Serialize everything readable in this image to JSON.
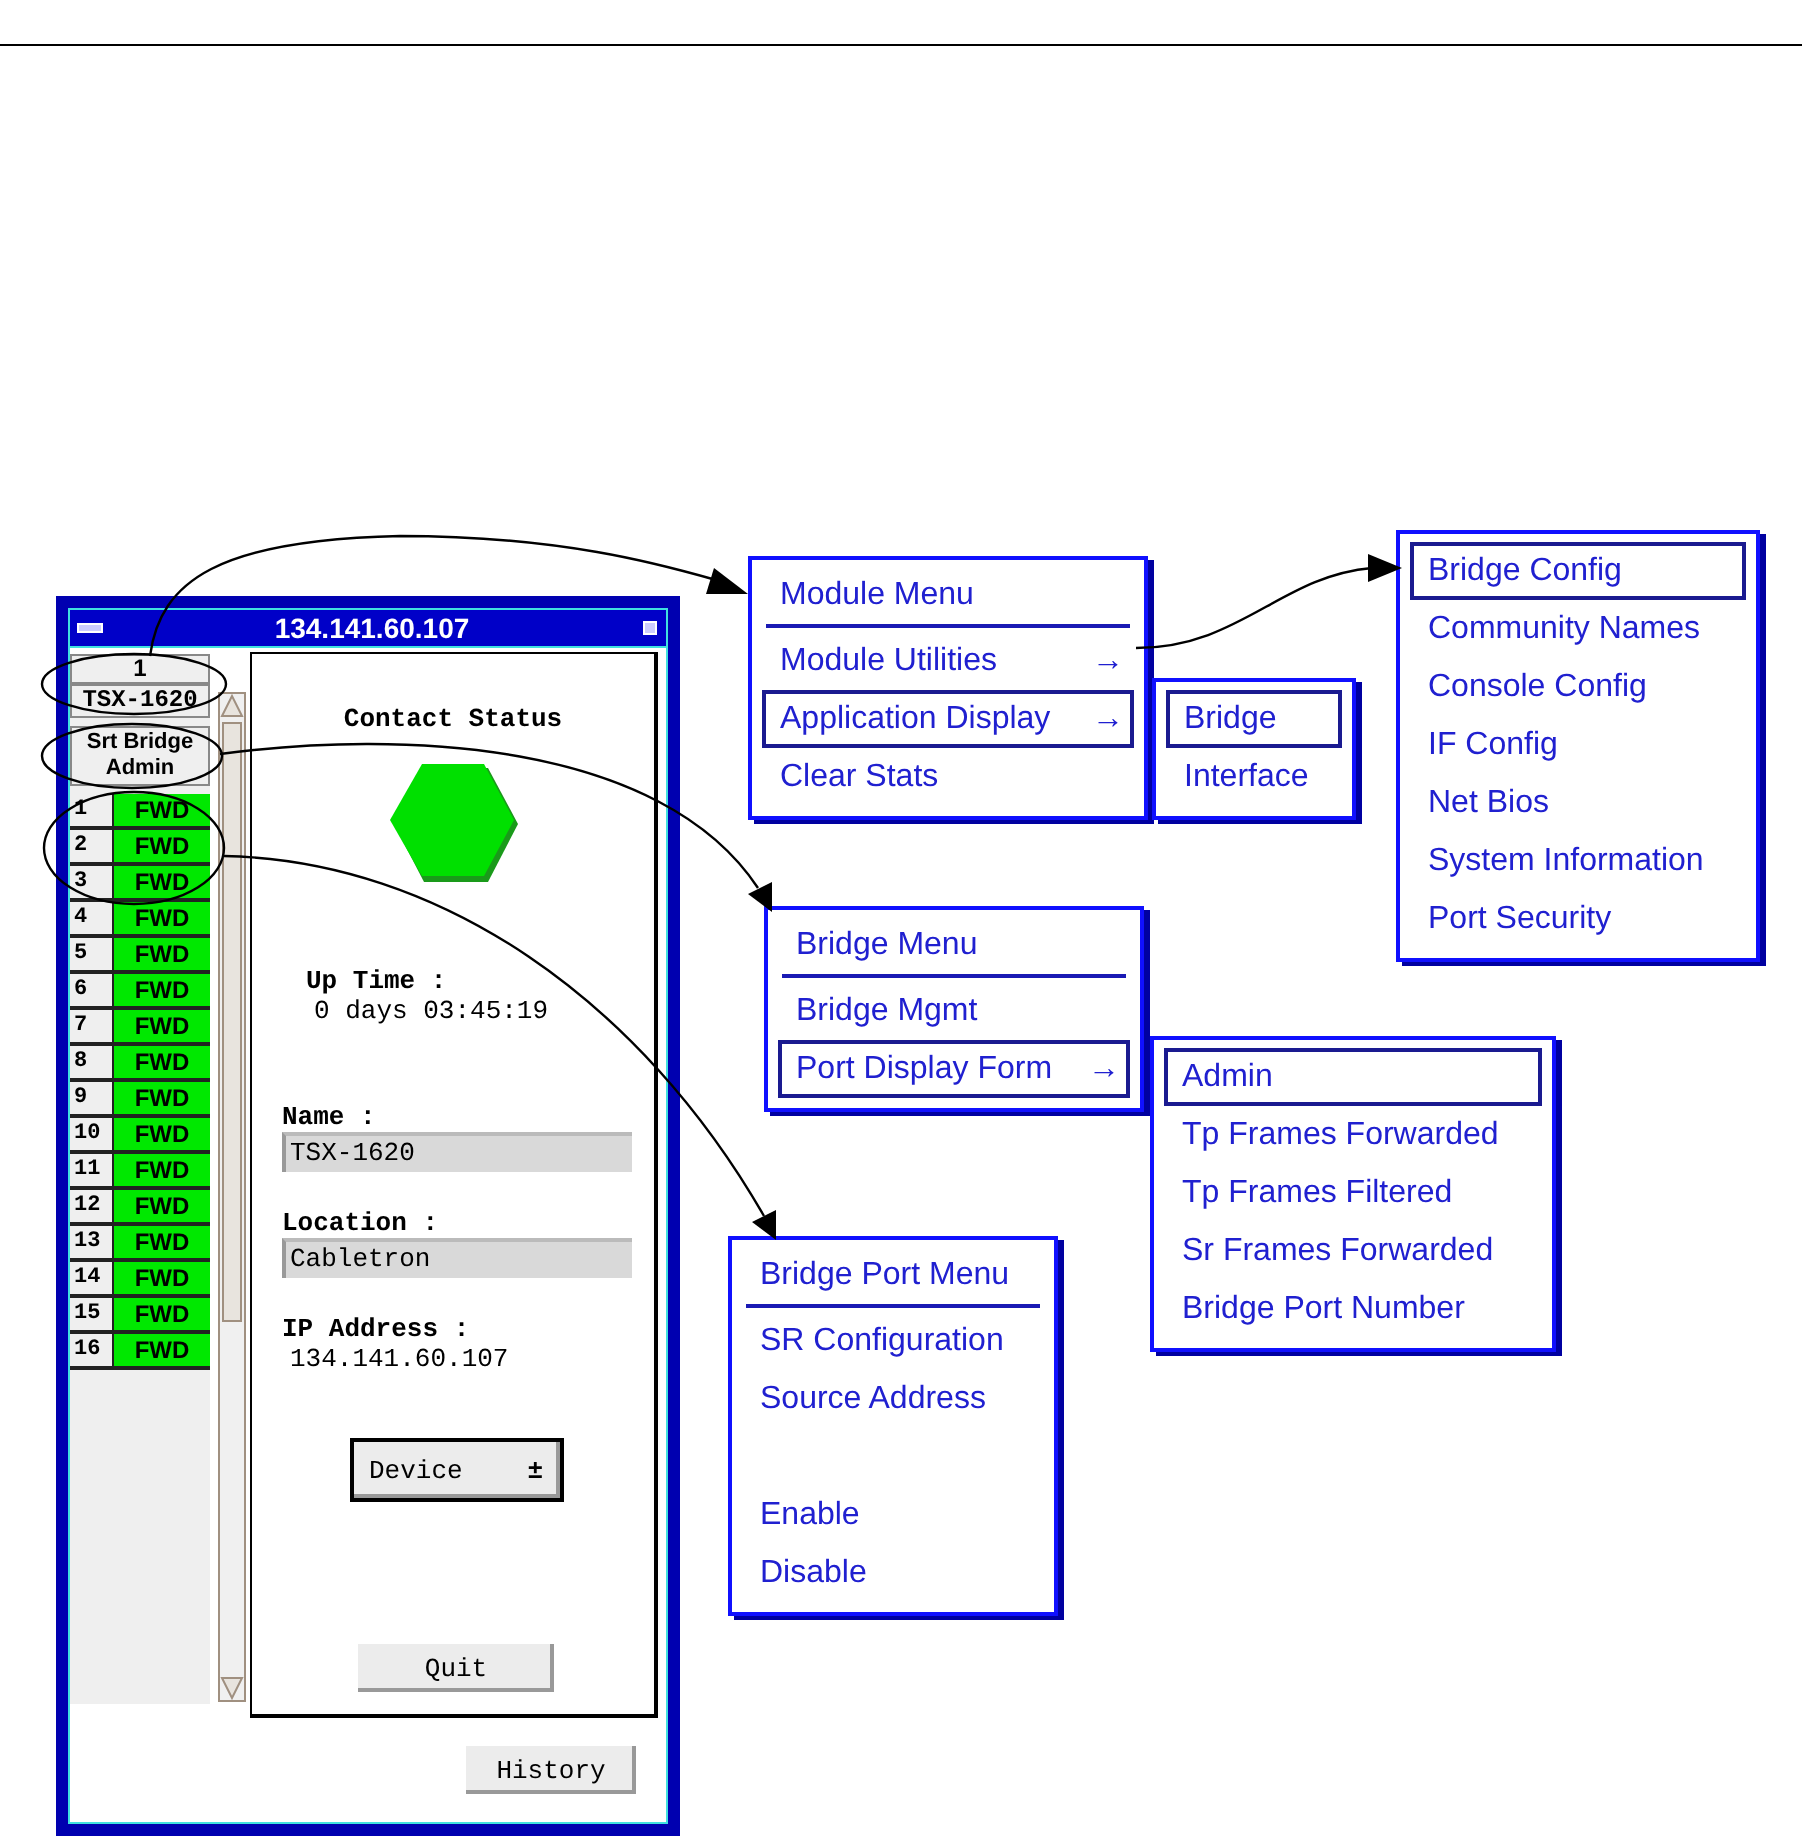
{
  "window": {
    "title": "134.141.60.107",
    "port_list": {
      "index": "1",
      "device": "TSX-1620",
      "mode": "Srt Bridge Admin",
      "ports": [
        {
          "number": "1",
          "state": "FWD"
        },
        {
          "number": "2",
          "state": "FWD"
        },
        {
          "number": "3",
          "state": "FWD"
        },
        {
          "number": "4",
          "state": "FWD"
        },
        {
          "number": "5",
          "state": "FWD"
        },
        {
          "number": "6",
          "state": "FWD"
        },
        {
          "number": "7",
          "state": "FWD"
        },
        {
          "number": "8",
          "state": "FWD"
        },
        {
          "number": "9",
          "state": "FWD"
        },
        {
          "number": "10",
          "state": "FWD"
        },
        {
          "number": "11",
          "state": "FWD"
        },
        {
          "number": "12",
          "state": "FWD"
        },
        {
          "number": "13",
          "state": "FWD"
        },
        {
          "number": "14",
          "state": "FWD"
        },
        {
          "number": "15",
          "state": "FWD"
        },
        {
          "number": "16",
          "state": "FWD"
        }
      ]
    },
    "contact_status": {
      "title": "Contact Status",
      "up_time": {
        "label": "Up Time :",
        "value": "0 days 03:45:19"
      },
      "name": {
        "label": "Name :",
        "value": "TSX-1620"
      },
      "location": {
        "label": "Location :",
        "value": "Cabletron"
      },
      "ip_address": {
        "label": "IP Address :",
        "value": "134.141.60.107"
      },
      "device_menu": "Device",
      "dropdown_mark": "±",
      "quit": "Quit"
    },
    "history": "History"
  },
  "menus": [
    {
      "title": "Module Menu",
      "items": [
        {
          "label": "Module Utilities",
          "arrow": "→",
          "selected": false
        },
        {
          "label": "Application Display",
          "arrow": "→",
          "selected": true
        },
        {
          "label": "Clear Stats",
          "selected": false
        }
      ]
    },
    {
      "items": [
        {
          "label": "Bridge",
          "selected": true
        },
        {
          "label": "Interface",
          "selected": false
        }
      ]
    },
    {
      "items": [
        {
          "label": "Bridge Config",
          "selected": true
        },
        {
          "label": "Community Names",
          "selected": false
        },
        {
          "label": "Console Config",
          "selected": false
        },
        {
          "label": "IF Config",
          "selected": false
        },
        {
          "label": "Net Bios",
          "selected": false
        },
        {
          "label": "System Information",
          "selected": false
        },
        {
          "label": "Port Security",
          "selected": false
        }
      ]
    },
    {
      "title": "Bridge Menu",
      "items": [
        {
          "label": "Bridge Mgmt",
          "selected": false
        },
        {
          "label": "Port Display Form",
          "arrow": "→",
          "selected": true
        }
      ]
    },
    {
      "items": [
        {
          "label": "Admin",
          "selected": true
        },
        {
          "label": "Tp Frames Forwarded",
          "selected": false
        },
        {
          "label": "Tp Frames Filtered",
          "selected": false
        },
        {
          "label": "Sr Frames Forwarded",
          "selected": false
        },
        {
          "label": "Bridge Port Number",
          "selected": false
        }
      ]
    },
    {
      "title": "Bridge Port Menu",
      "items": [
        {
          "label": "SR Configuration",
          "selected": false
        },
        {
          "label": "Source Address",
          "selected": false
        }
      ],
      "extra_items": [
        {
          "label": "Enable",
          "selected": false
        },
        {
          "label": "Disable",
          "selected": false
        }
      ]
    }
  ]
}
